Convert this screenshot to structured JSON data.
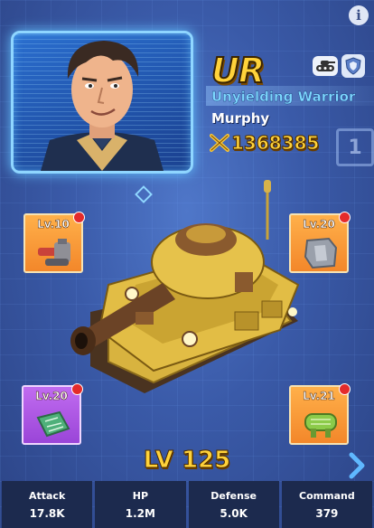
{
  "hero": {
    "rarity": "UR",
    "title": "Unyielding Warrior",
    "name": "Murphy",
    "power": "1368385",
    "badge_number": "1"
  },
  "equipment": [
    {
      "slot": "top-left",
      "level": "Lv.10",
      "icon": "cannon-icon",
      "color": "orange"
    },
    {
      "slot": "top-right",
      "level": "Lv.20",
      "icon": "armor-plate-icon",
      "color": "orange"
    },
    {
      "slot": "bottom-left",
      "level": "Lv.20",
      "icon": "circuit-board-icon",
      "color": "purple"
    },
    {
      "slot": "bottom-right",
      "level": "Lv.21",
      "icon": "track-icon",
      "color": "orange"
    }
  ],
  "tank": {
    "level": "LV 125"
  },
  "stats": [
    {
      "label": "Attack",
      "value": "17.8K"
    },
    {
      "label": "HP",
      "value": "1.2M"
    },
    {
      "label": "Defense",
      "value": "5.0K"
    },
    {
      "label": "Command",
      "value": "379"
    }
  ],
  "colors": {
    "accent_gold": "#ffd23a",
    "title_blue": "#7dd8ff",
    "panel_dark": "#1c2a4e"
  }
}
